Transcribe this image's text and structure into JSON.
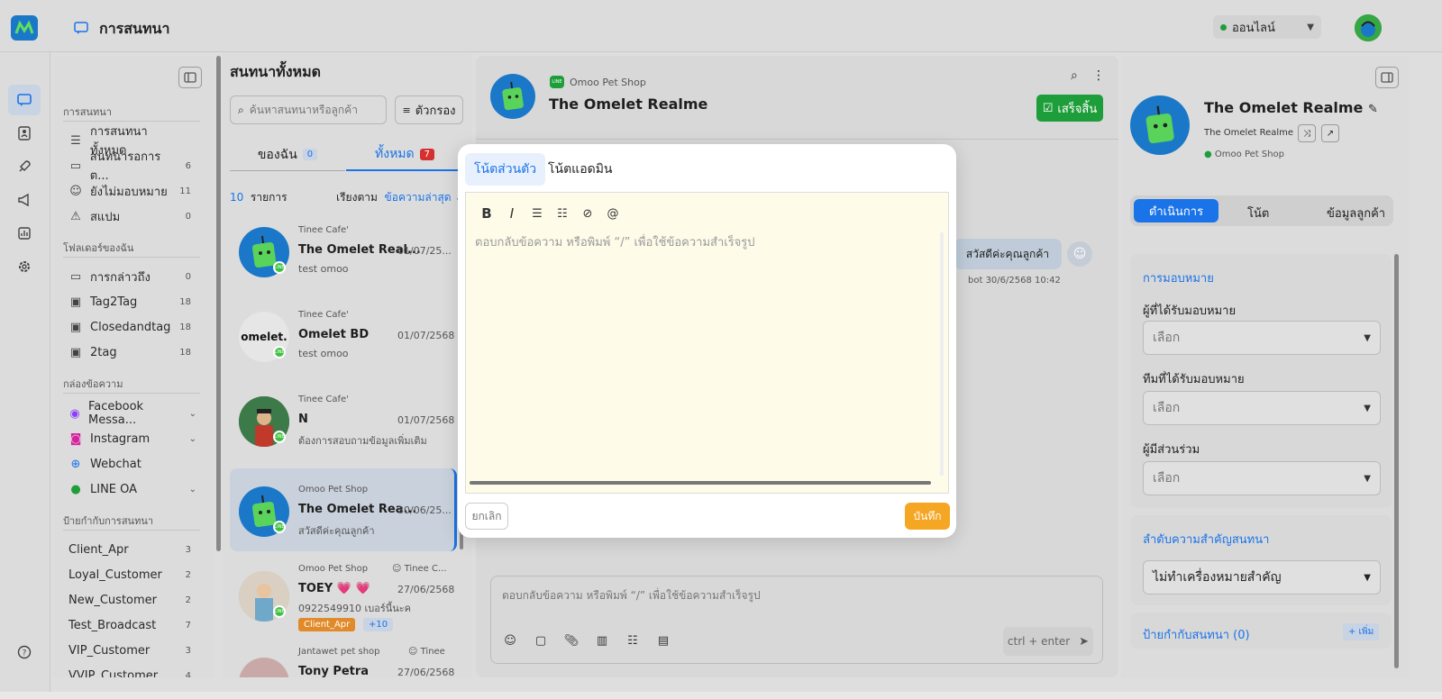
{
  "app": {
    "title": "การสนทนา",
    "status": "ออนไลน์"
  },
  "sidebar": {
    "section_chat": "การสนทนา",
    "chat_items": [
      {
        "label": "การสนทนาทั้งหมด",
        "count": ""
      },
      {
        "label": "สนทนารอการต...",
        "count": "6"
      },
      {
        "label": "ยังไม่มอบหมาย",
        "count": "11"
      },
      {
        "label": "สแปม",
        "count": "0"
      }
    ],
    "section_folders": "โฟลเดอร์ของฉัน",
    "folder_items": [
      {
        "label": "การกล่าวถึง",
        "count": "0"
      },
      {
        "label": "Tag2Tag",
        "count": "18"
      },
      {
        "label": "Closedandtag",
        "count": "18"
      },
      {
        "label": "2tag",
        "count": "18"
      }
    ],
    "section_inbox": "กล่องข้อความ",
    "inbox_items": [
      {
        "label": "Facebook Messa..."
      },
      {
        "label": "Instagram"
      },
      {
        "label": "Webchat"
      },
      {
        "label": "LINE OA"
      }
    ],
    "section_tags": "ป้ายกำกับการสนทนา",
    "tag_items": [
      {
        "label": "Client_Apr",
        "count": "3"
      },
      {
        "label": "Loyal_Customer",
        "count": "2"
      },
      {
        "label": "New_Customer",
        "count": "2"
      },
      {
        "label": "Test_Broadcast",
        "count": "7"
      },
      {
        "label": "VIP_Customer",
        "count": "3"
      },
      {
        "label": "VVIP_Customer",
        "count": "4"
      }
    ]
  },
  "list": {
    "title": "สนทนาทั้งหมด",
    "search_placeholder": "ค้นหาสนทนาหรือลูกค้า",
    "filter_label": "ตัวกรอง",
    "tab_mine": "ของฉัน",
    "tab_mine_count": "0",
    "tab_all": "ทั้งหมด",
    "tab_all_count": "7",
    "total_count": "10",
    "total_label": "รายการ",
    "sort_label": "เรียงตาม",
    "sort_value": "ข้อความล่าสุด",
    "conversations": [
      {
        "shop": "Tinee Cafe'",
        "name": "The Omelet Real...",
        "date": "01/07/25...",
        "preview": "test omoo"
      },
      {
        "shop": "Tinee Cafe'",
        "name": "Omelet BD",
        "date": "01/07/2568",
        "preview": "test omoo",
        "avatar_text": "omelet."
      },
      {
        "shop": "Tinee Cafe'",
        "name": "N",
        "date": "01/07/2568",
        "preview": "ต้องการสอบถามข้อมูลเพิ่มเติม"
      },
      {
        "shop": "Omoo Pet Shop",
        "name": "The Omelet Rea...",
        "date": "30/06/25...",
        "preview": "สวัสดีค่ะคุณลูกค้า"
      },
      {
        "shop": "Omoo Pet Shop",
        "agent": "Tinee C...",
        "name": "TOEY 💗 💗",
        "date": "27/06/2568",
        "preview": "0922549910 เบอร์นี้นะค",
        "tag": "Client_Apr",
        "more": "+10"
      },
      {
        "shop": "Jantawet pet shop",
        "agent": "Tinee",
        "name": "Tony Petra",
        "date": "27/06/2568"
      }
    ]
  },
  "chat": {
    "shop": "Omoo Pet Shop",
    "name": "The Omelet Realme",
    "finish_label": "เสร็จสิ้น",
    "bubble": "สวัสดีค่ะคุณลูกค้า",
    "bubble_meta": "bot 30/6/2568 10:42",
    "composer_placeholder": "ตอบกลับข้อความ หรือพิมพ์ “/” เพื่อใช้ข้อความสำเร็จรูป",
    "send_hint": "ctrl + enter"
  },
  "modal": {
    "tab_private": "โน้ตส่วนตัว",
    "tab_admin": "โน้ตแอดมิน",
    "placeholder": "ตอบกลับข้อความ หรือพิมพ์ “/” เพื่อใช้ข้อความสำเร็จรูป",
    "mention": "@",
    "bold": "B",
    "italic": "I",
    "cancel": "ยกเลิก",
    "save": "บันทึก"
  },
  "profile": {
    "name": "The Omelet Realme",
    "sub": "The Omelet Realme",
    "shop": "Omoo Pet Shop",
    "tab_action": "ดำเนินการ",
    "tab_note": "โน้ต",
    "tab_info": "ข้อมูลลูกค้า",
    "assign_title": "การมอบหมาย",
    "assignee_label": "ผู้ที่ได้รับมอบหมาย",
    "team_label": "ทีมที่ได้รับมอบหมาย",
    "participant_label": "ผู้มีส่วนร่วม",
    "select_placeholder": "เลือก",
    "priority_title": "ลำดับความสำคัญสนทนา",
    "priority_value": "ไม่ทำเครื่องหมายสำคัญ",
    "tags_title": "ป้ายกำกับสนทนา (0)",
    "add_label": "+ เพิ่ม"
  },
  "colors": {
    "accent": "#1a73e8",
    "green": "#1e9e3a",
    "orange": "#f5a623",
    "red": "#d62f2f"
  }
}
